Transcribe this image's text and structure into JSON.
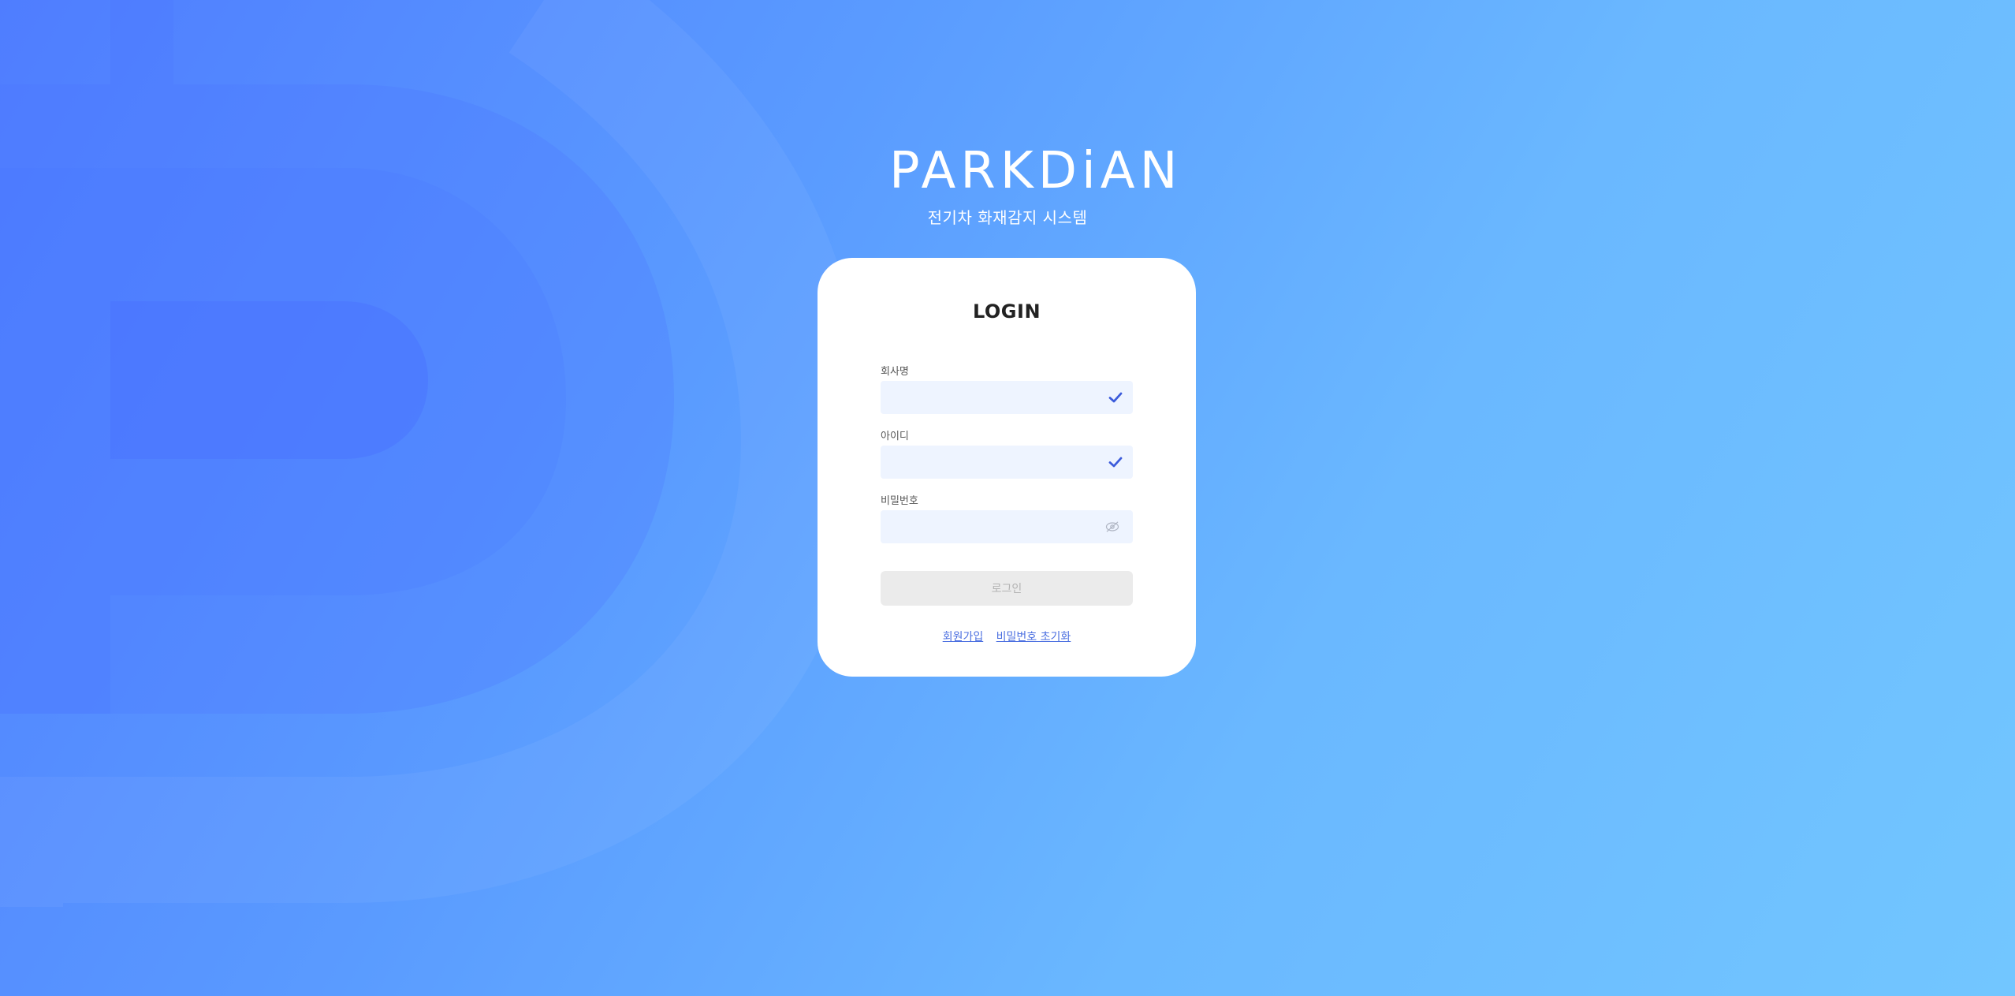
{
  "brand": {
    "logo_text": "PARKDiAN",
    "subtitle": "전기차 화재감지 시스템"
  },
  "login": {
    "title": "LOGIN",
    "fields": [
      {
        "label": "회사명",
        "value": "",
        "icon": "check-icon"
      },
      {
        "label": "아이디",
        "value": "",
        "icon": "check-icon"
      },
      {
        "label": "비밀번호",
        "value": "",
        "icon": "eye-off-icon"
      }
    ],
    "submit_label": "로그인",
    "links": {
      "signup": "회원가입",
      "reset_password": "비밀번호 초기화"
    }
  },
  "colors": {
    "background_start": "#4f7dff",
    "background_end": "#72c6ff",
    "check_icon": "#3b5bdb",
    "link": "#4a6ee0",
    "input_bg": "#eef4ff",
    "button_disabled_bg": "#ebebeb"
  }
}
